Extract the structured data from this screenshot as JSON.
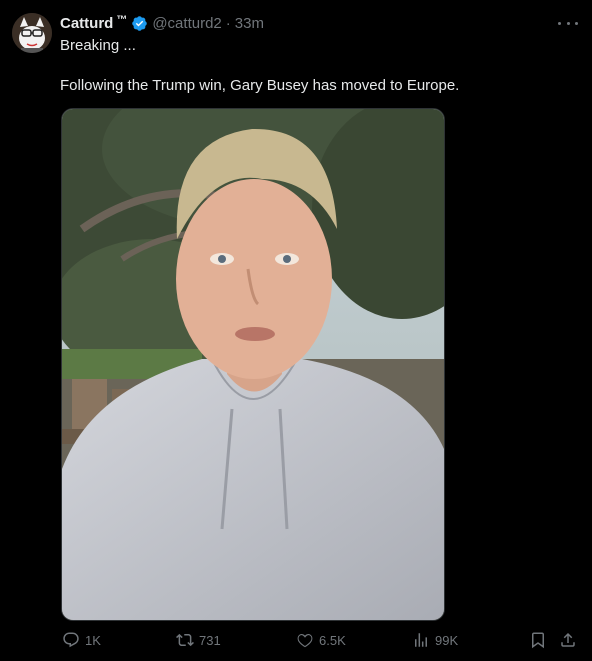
{
  "author": {
    "name": "Catturd",
    "name_suffix": "™",
    "handle": "@catturd2",
    "time": "33m"
  },
  "tweet": {
    "line1": "Breaking ...",
    "line2": "Following the Trump win, Gary Busey has moved to Europe."
  },
  "actions": {
    "replies": "1K",
    "reposts": "731",
    "likes": "6.5K",
    "views": "99K"
  },
  "colors": {
    "background": "#000000",
    "text": "#e7e9ea",
    "muted": "#71767b",
    "verified": "#1d9bf0"
  },
  "icons": [
    "avatar",
    "verified-badge-icon",
    "more-icon",
    "reply-icon",
    "repost-icon",
    "like-icon",
    "views-icon",
    "bookmark-icon",
    "share-icon"
  ]
}
